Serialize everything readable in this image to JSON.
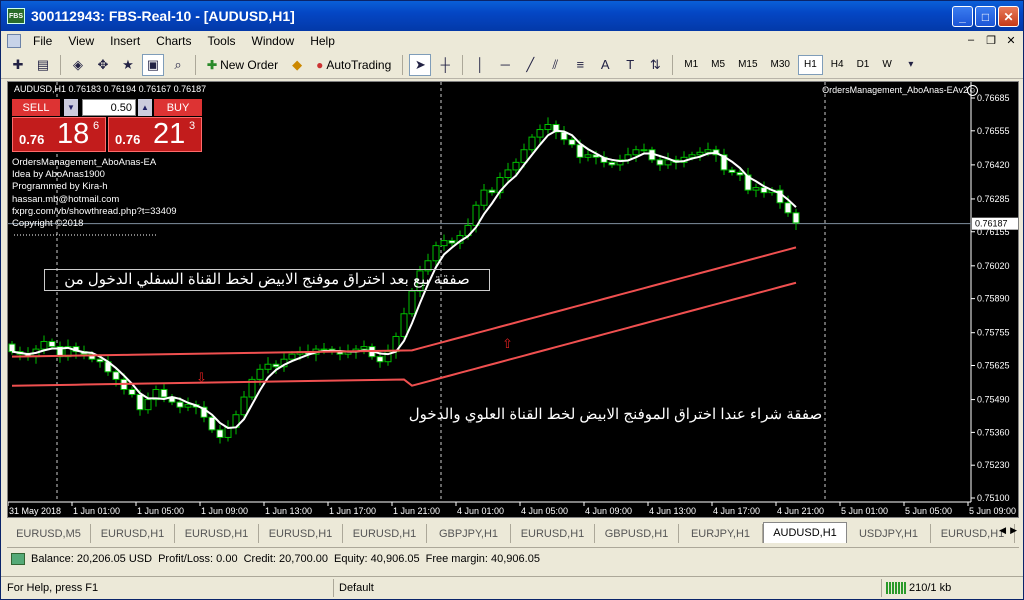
{
  "window": {
    "app_icon_text": "FBS",
    "title": "300112943: FBS-Real-10 - [AUDUSD,H1]"
  },
  "menu": [
    "File",
    "View",
    "Insert",
    "Charts",
    "Tools",
    "Window",
    "Help"
  ],
  "toolbar": {
    "new_order": "New Order",
    "auto_trading": "AutoTrading",
    "timeframes": [
      "M1",
      "M5",
      "M15",
      "M30",
      "H1",
      "H4",
      "D1",
      "W"
    ],
    "active_timeframe": "H1"
  },
  "chart": {
    "header": "AUDUSD,H1  0.76183 0.76194 0.76167 0.76187",
    "ea_name": "OrdersManagement_AboAnas-EAv2",
    "panel": {
      "sell_label": "SELL",
      "buy_label": "BUY",
      "lot": "0.50",
      "sell_small": "0.76",
      "sell_big": "18",
      "sell_sup": "6",
      "buy_small": "0.76",
      "buy_big": "21",
      "buy_sup": "3"
    },
    "info": [
      "OrdersManagement_AboAnas-EA",
      "Idea by AboAnas1900",
      "Programmed by Kira-h",
      "hassan.mb@hotmail.com",
      "fxprg.com/vb/showthread.php?t=33409",
      "Copyright ©2018"
    ],
    "annotation_sell": "صفقة بيع بعد اختراق موفنج  الابيض لخط القناة السفلي  الدخول من",
    "annotation_buy": "صفقة شراء عندا اختراق الموفنج الابيض لخط القناة العلوي والدخول",
    "current_price": "0.76187",
    "price_ticks": [
      "0.76685",
      "0.76555",
      "0.76420",
      "0.76285",
      "0.76155",
      "0.76020",
      "0.75890",
      "0.75755",
      "0.75625",
      "0.75490",
      "0.75360",
      "0.75230",
      "0.75100"
    ],
    "time_ticks": [
      "31 May 2018",
      "1 Jun 01:00",
      "1 Jun 05:00",
      "1 Jun 09:00",
      "1 Jun 13:00",
      "1 Jun 17:00",
      "1 Jun 21:00",
      "4 Jun 01:00",
      "4 Jun 05:00",
      "4 Jun 09:00",
      "4 Jun 13:00",
      "4 Jun 17:00",
      "4 Jun 21:00",
      "5 Jun 01:00",
      "5 Jun 05:00",
      "5 Jun 09:00"
    ]
  },
  "tabs": [
    "EURUSD,M5",
    "EURUSD,H1",
    "EURUSD,H1",
    "EURUSD,H1",
    "EURUSD,H1",
    "GBPJPY,H1",
    "EURUSD,H1",
    "GBPUSD,H1",
    "EURJPY,H1",
    "AUDUSD,H1",
    "USDJPY,H1",
    "EURUSD,H1"
  ],
  "active_tab_index": 9,
  "account": {
    "balance": "Balance: 20,206.05 USD",
    "profit": "Profit/Loss: 0.00",
    "credit": "Credit: 20,700.00",
    "equity": "Equity: 40,906.05",
    "free_margin": "Free margin: 40,906.05"
  },
  "status": {
    "help": "For Help, press F1",
    "profile": "Default",
    "traffic": "210/1 kb"
  }
}
